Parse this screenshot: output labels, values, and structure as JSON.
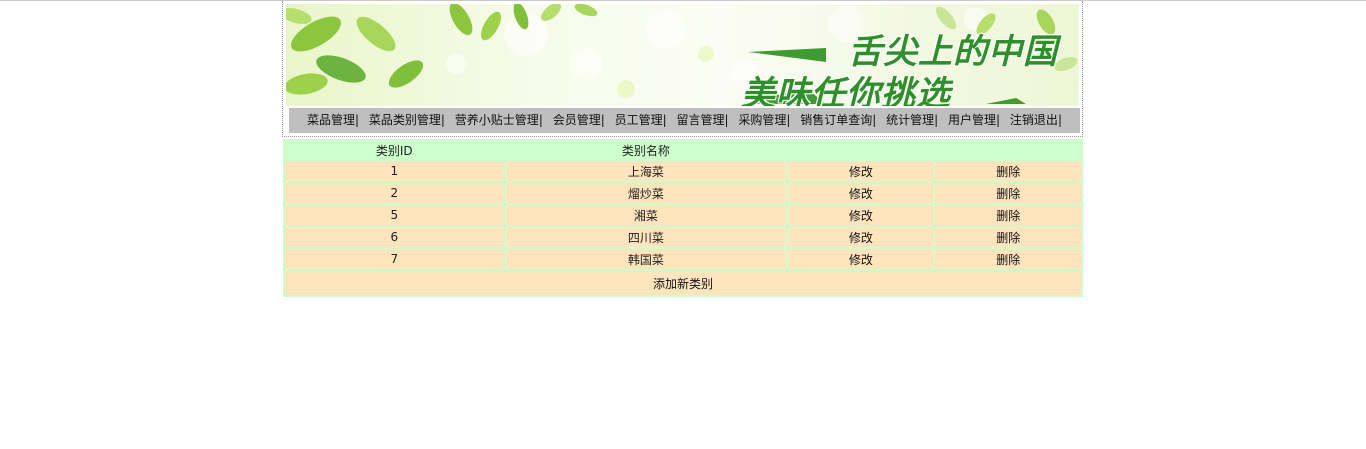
{
  "banner": {
    "title_line1": "舌尖上的中国",
    "title_line2": "美味任你挑选"
  },
  "nav": {
    "items": [
      "菜品管理",
      "菜品类别管理",
      "营养小贴士管理",
      "会员管理",
      "员工管理",
      "留言管理",
      "采购管理",
      "销售订单查询",
      "统计管理",
      "用户管理",
      "注销退出"
    ],
    "separator": "|"
  },
  "table": {
    "headers": {
      "id": "类别ID",
      "name": "类别名称"
    },
    "rows": [
      {
        "id": "1",
        "name": "上海菜",
        "edit": "修改",
        "delete": "删除"
      },
      {
        "id": "2",
        "name": "熘炒菜",
        "edit": "修改",
        "delete": "删除"
      },
      {
        "id": "5",
        "name": "湘菜",
        "edit": "修改",
        "delete": "删除"
      },
      {
        "id": "6",
        "name": "四川菜",
        "edit": "修改",
        "delete": "删除"
      },
      {
        "id": "7",
        "name": "韩国菜",
        "edit": "修改",
        "delete": "删除"
      }
    ],
    "add_label": "添加新类别"
  },
  "colors": {
    "header_bg": "#ccffcc",
    "row_bg": "#ffe4bd",
    "nav_bg": "#bfbfbf"
  }
}
